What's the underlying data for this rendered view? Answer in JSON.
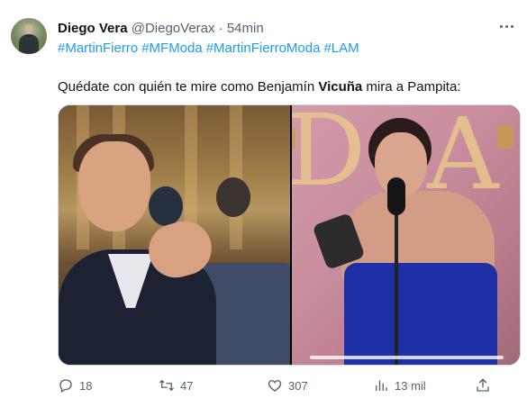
{
  "tweet": {
    "author_name": "Diego Vera",
    "handle": "@DiegoVerax",
    "separator": "·",
    "time": "54min",
    "hashtags": [
      "#MartinFierro",
      "#MFModa",
      "#MartinFierroModa",
      "#LAM"
    ],
    "text_before": "Quédate con quién te mire como Benjamín ",
    "text_bold": "Vicuña",
    "text_after": " mira a Pampita:"
  },
  "media": {
    "letters": [
      "D",
      "A"
    ]
  },
  "actions": {
    "reply": {
      "icon": "reply-icon",
      "count": "18"
    },
    "retweet": {
      "icon": "retweet-icon",
      "count": "47"
    },
    "like": {
      "icon": "heart-icon",
      "count": "307"
    },
    "views": {
      "icon": "views-icon",
      "count": "13 mil"
    },
    "share": {
      "icon": "share-icon"
    }
  },
  "colors": {
    "accent": "#1d9bf0",
    "text": "#0f1419",
    "muted": "#536471"
  }
}
